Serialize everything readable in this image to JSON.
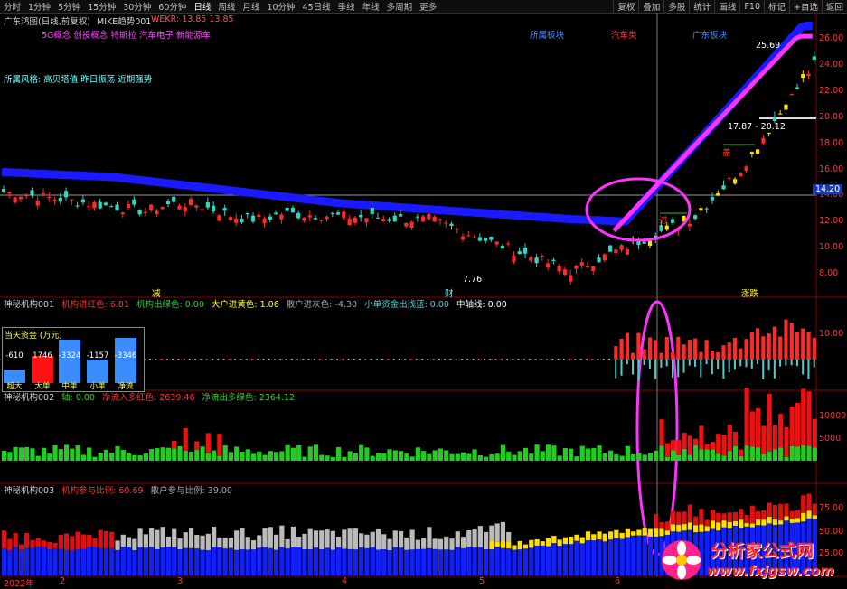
{
  "toolbar": {
    "tabs": [
      "分时",
      "1分钟",
      "5分钟",
      "15分钟",
      "30分钟",
      "60分钟",
      "日线",
      "周线",
      "月线",
      "10分钟",
      "45日线",
      "季线",
      "年线",
      "多周期",
      "更多"
    ],
    "active_tab": "日线",
    "right_buttons": [
      "复权",
      "叠加",
      "多股",
      "统计",
      "画线",
      "F10",
      "标记",
      "+自选",
      "返回"
    ]
  },
  "main_panel": {
    "title": "广东鸿图(日线,前复权)",
    "indicator_name": "MIKE趋势001",
    "indicator_values": "WEKR: 13.85  13.85",
    "concepts": "5G概念 创投概念 特斯拉 汽车电子 新能源车",
    "style": "所属风格: 高贝塔值 昨日振荡 近期强势",
    "tag_sector": "所属板块",
    "tag_car": "汽车类",
    "tag_guangdong": "广东板块",
    "price_axis": [
      "26.00",
      "24.00",
      "22.00",
      "20.00",
      "18.00",
      "16.00",
      "14.00",
      "12.00",
      "10.00",
      "8.00"
    ],
    "crosshair_price": "14.20",
    "high_label": "25.69",
    "low_label": "7.76",
    "range_label": "17.87 - 20.12",
    "mark_jian": "减",
    "mark_cai": "财",
    "mark_zhangdie": "涨跌",
    "mark_gai": "盖",
    "mark_jin": "进"
  },
  "panel2": {
    "header": [
      {
        "text": "神秘机构001",
        "color": "#d0d0d0"
      },
      {
        "text": "机构进红色: 6.81",
        "color": "#ff3333"
      },
      {
        "text": "机构出绿色: 0.00",
        "color": "#33cc33"
      },
      {
        "text": "大户进黄色: 1.06",
        "color": "#ffff33"
      },
      {
        "text": "散户进灰色: -4.30",
        "color": "#aaaaaa"
      },
      {
        "text": "小单资金出浅蓝: 0.00",
        "color": "#55cccc"
      },
      {
        "text": "中轴线: 0.00",
        "color": "#ffffff"
      }
    ],
    "axis": [
      "10.00"
    ],
    "cash_box": {
      "title": "当天资金 (万元)",
      "items": [
        {
          "label": "超大",
          "value": "-610",
          "color": "#3a8cff"
        },
        {
          "label": "大单",
          "value": "1746",
          "color": "#ff1111"
        },
        {
          "label": "中单",
          "value": "-3324",
          "color": "#3a8cff"
        },
        {
          "label": "小单",
          "value": "-1157",
          "color": "#3a8cff"
        },
        {
          "label": "净流",
          "value": "-3346",
          "color": "#3a8cff"
        }
      ]
    }
  },
  "panel3": {
    "header": [
      {
        "text": "神秘机构002",
        "color": "#d0d0d0"
      },
      {
        "text": "轴: 0.00",
        "color": "#33cc33"
      },
      {
        "text": "净流入多红色: 2639.46",
        "color": "#ff3333"
      },
      {
        "text": "净流出多绿色: 2364.12",
        "color": "#33cc33"
      }
    ],
    "axis": [
      "10000",
      "5000"
    ]
  },
  "panel4": {
    "header": [
      {
        "text": "神秘机构003",
        "color": "#d0d0d0"
      },
      {
        "text": "机构参与比例: 60.69",
        "color": "#ff3333"
      },
      {
        "text": "散户参与比例: 39.00",
        "color": "#aaaaaa"
      }
    ],
    "axis": [
      "75.00",
      "50.00",
      "25.00"
    ]
  },
  "date_axis": [
    "2022年",
    "2",
    "3",
    "4",
    "5",
    "6"
  ],
  "watermark": {
    "line1": "分析家公式网",
    "line2": "www.fxjgsw.com"
  },
  "colors": {
    "up": "#ff2a2a",
    "down": "#33d6c0",
    "band": "#1a1aff",
    "trend": "#ff33ff",
    "highlight": "#ffe000",
    "circle": "#ff33ff"
  }
}
